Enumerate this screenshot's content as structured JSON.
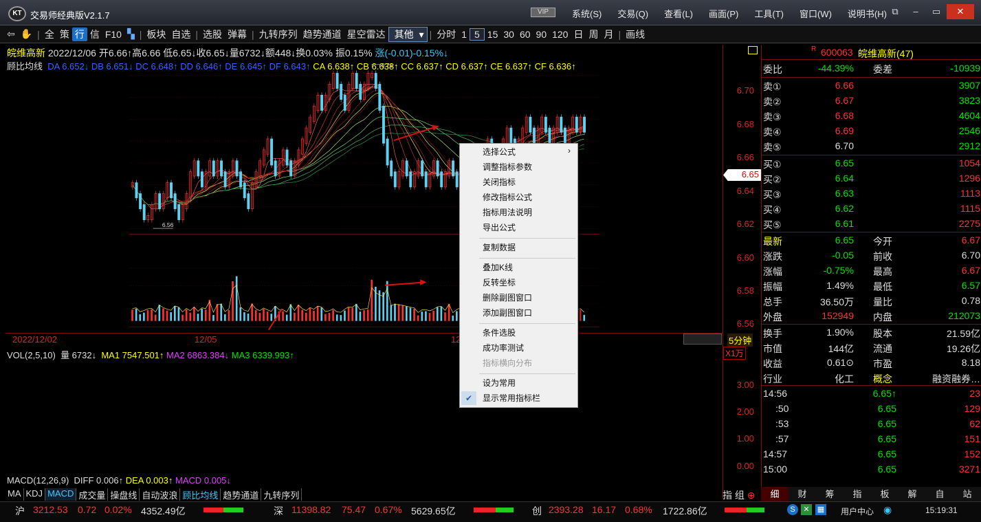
{
  "app": {
    "logo": "KT",
    "title": "交易师经典版V2.1.7",
    "vip": "VIP",
    "menus": [
      "系统(S)",
      "交易(Q)",
      "查看(L)",
      "画面(P)",
      "工具(T)",
      "窗口(W)",
      "说明书(H)"
    ],
    "win": [
      "⧉",
      "–",
      "▭",
      "✕"
    ]
  },
  "toolbar": {
    "items": [
      "全",
      "策",
      "行",
      "信",
      "F10",
      "板块",
      "自选",
      "选股",
      "弹幕",
      "九转序列",
      "趋势通道",
      "星空雷达"
    ],
    "select": "其他",
    "periods": [
      "分时",
      "1",
      "5",
      "15",
      "30",
      "60",
      "90",
      "120",
      "日",
      "周",
      "月"
    ],
    "draw": "画线"
  },
  "kline": {
    "line1": [
      "皖维高新",
      "2022/12/06",
      "开6.66↑",
      "高6.66",
      "低6.65↓",
      "收6.65↓",
      "量6732↓",
      "额448↓",
      "换0.03%",
      "振0.15%",
      "涨(-0.01)-0.15%↓"
    ],
    "line2_label": "顾比均线",
    "short_ma": [
      "DA 6.652↓",
      "DB 6.651↓",
      "DC 6.648↑",
      "DD 6.646↑",
      "DE 6.645↑",
      "DF 6.643↑"
    ],
    "long_ma": [
      "CA 6.638↑",
      "CB 6.638↑",
      "CC 6.637↑",
      "CD 6.637↑",
      "CE 6.637↑",
      "CF 6.636↑"
    ],
    "y_labels": [
      "6.70",
      "6.68",
      "6.66",
      "6.64",
      "6.62",
      "6.60",
      "6.58",
      "6.56"
    ],
    "current_price": "6.65",
    "max_label": "6.71",
    "min_label": "6.56",
    "dates": [
      "2022/12/02",
      "12/05",
      "12"
    ],
    "period": "5分钟"
  },
  "volume": {
    "label": "VOL(2,5,10)",
    "vol": "量 6732↓",
    "ma1": "MA1 7547.501↑",
    "ma2": "MA2 6863.384↓",
    "ma3": "MA3 6339.993↑",
    "unit": "X1万",
    "y_labels": [
      "3.00",
      "2.00",
      "1.00",
      "0.00"
    ]
  },
  "macd": {
    "label": "MACD(12,26,9)",
    "diff": "DIFF 0.006↑",
    "dea": "DEA 0.003↑",
    "macd": "MACD 0.005↓"
  },
  "tabs": [
    "MA",
    "KDJ",
    "MACD",
    "成交量",
    "操盘线",
    "自动波浪",
    "顾比均线",
    "趋势通道",
    "九转序列"
  ],
  "zhizu": "指 组",
  "context_menu": [
    "选择公式",
    "调整指标参数",
    "关闭指标",
    "修改指标公式",
    "指标用法说明",
    "导出公式",
    "复制数据",
    "叠加K线",
    "反转坐标",
    "删除副图窗口",
    "添加副图窗口",
    "条件选股",
    "成功率测试",
    "指标横向分布",
    "设为常用",
    "显示常用指标栏"
  ],
  "quote": {
    "badge": "R",
    "code": "600063",
    "name": "皖维高新(47)",
    "weibi": {
      "l": "委比",
      "v": "-44.39%",
      "l2": "委差",
      "v2": "-10939"
    },
    "sell": [
      {
        "l": "卖⑤",
        "p": "6.70",
        "q": "2912"
      },
      {
        "l": "卖④",
        "p": "6.69",
        "q": "2546"
      },
      {
        "l": "卖③",
        "p": "6.68",
        "q": "4604"
      },
      {
        "l": "卖②",
        "p": "6.67",
        "q": "3823"
      },
      {
        "l": "卖①",
        "p": "6.66",
        "q": "3907"
      }
    ],
    "buy": [
      {
        "l": "买①",
        "p": "6.65",
        "q": "1054"
      },
      {
        "l": "买②",
        "p": "6.64",
        "q": "1296"
      },
      {
        "l": "买③",
        "p": "6.63",
        "q": "1113"
      },
      {
        "l": "买④",
        "p": "6.62",
        "q": "1115"
      },
      {
        "l": "买⑤",
        "p": "6.61",
        "q": "2275"
      }
    ],
    "stats": [
      [
        "最新",
        "6.65",
        "今开",
        "6.67"
      ],
      [
        "涨跌",
        "-0.05",
        "前收",
        "6.70"
      ],
      [
        "涨幅",
        "-0.75%",
        "最高",
        "6.67"
      ],
      [
        "振幅",
        "1.49%",
        "最低",
        "6.57"
      ],
      [
        "总手",
        "36.50万",
        "量比",
        "0.78"
      ],
      [
        "外盘",
        "152949",
        "内盘",
        "212073"
      ]
    ],
    "stats2": [
      [
        "换手",
        "1.90%",
        "股本",
        "21.59亿"
      ],
      [
        "市值",
        "144亿",
        "流通",
        "19.26亿"
      ],
      [
        "收益",
        "0.61⊙",
        "市盈",
        "8.18"
      ],
      [
        "行业",
        "化工",
        "概念",
        "融资融券…"
      ]
    ],
    "ticks": [
      [
        "14:56",
        "6.65↑",
        "23"
      ],
      [
        ":50",
        "6.65",
        "129"
      ],
      [
        ":53",
        "6.65",
        "62"
      ],
      [
        ":57",
        "6.65",
        "151"
      ],
      [
        "14:57",
        "6.65",
        "152"
      ],
      [
        "15:00",
        "6.65",
        "3271"
      ]
    ],
    "bottom_tabs": [
      "细",
      "财",
      "筹",
      "指",
      "板",
      "解",
      "自",
      "站"
    ]
  },
  "status": {
    "sh": {
      "n": "沪",
      "p": "3212.53",
      "c": "0.72",
      "pct": "0.02%",
      "amt": "4352.49亿"
    },
    "sz": {
      "n": "深",
      "p": "11398.82",
      "c": "75.47",
      "pct": "0.67%",
      "amt": "5629.65亿"
    },
    "cy": {
      "n": "创",
      "p": "2393.28",
      "c": "16.17",
      "pct": "0.68%",
      "amt": "1722.86亿"
    },
    "user": "用户中心",
    "time": "15:19:31"
  },
  "colors": {
    "up": "#ff3232",
    "down": "#00e600",
    "axis": "#7a1010",
    "menu_bg": "#f0f0f0"
  }
}
